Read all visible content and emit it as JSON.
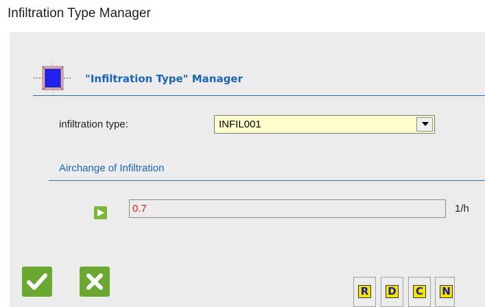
{
  "window": {
    "title": "Infiltration Type Manager"
  },
  "header": {
    "title": "\"Infiltration Type\" Manager",
    "icon": "infiltration-type-icon"
  },
  "form": {
    "type_label": "infiltration type:",
    "type_value": "INFIL001",
    "section_title": "Airchange of Infiltration",
    "airchange_value": "0.7",
    "airchange_unit": "1/h"
  },
  "actions": {
    "ok_icon": "checkmark-icon",
    "cancel_icon": "x-icon",
    "letter_buttons": [
      "R",
      "D",
      "C",
      "N"
    ]
  },
  "colors": {
    "accent_blue": "#1c64b4",
    "action_green": "#6aa832",
    "select_bg": "#ffffcc",
    "value_red": "#cc2222",
    "letter_button_yellow": "#f4e300"
  }
}
